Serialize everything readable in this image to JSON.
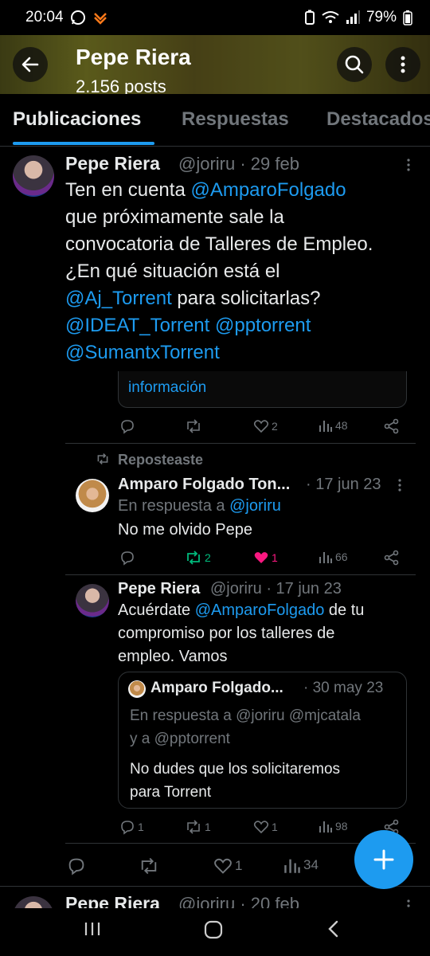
{
  "status_bar": {
    "time": "20:04",
    "battery": "79%"
  },
  "header": {
    "title": "Pepe Riera",
    "subtitle": "2.156 posts"
  },
  "tabs": [
    {
      "label": "Publicaciones",
      "active": true
    },
    {
      "label": "Respuestas",
      "active": false
    },
    {
      "label": "Destacados",
      "active": false
    }
  ],
  "main_post": {
    "name": "Pepe Riera",
    "handle": "@joriru",
    "date": "29 feb",
    "text_parts": {
      "t1": "Ten en cuenta ",
      "m1": "@AmparoFolgado",
      "t2": "que próximamente sale la",
      "t3": "convocatoria de Talleres de Empleo.",
      "t4": "¿En qué situación está el",
      "m2": "@Aj_Torrent",
      "t5": " para solicitarlas?",
      "m3": "@IDEAT_Torrent",
      "m4": "@pptorrent",
      "m5": "@SumantxTorrent"
    },
    "card_link": "información",
    "stats": {
      "replies": "",
      "reposts": "",
      "likes": "2",
      "views": "48"
    }
  },
  "reply_1": {
    "repost_label": "Reposteaste",
    "name": "Amparo Folgado Ton...",
    "date": "17 jun 23",
    "reply_to_label": "En respuesta a",
    "reply_to_handle": "@joriru",
    "text": "No me olvido Pepe",
    "stats": {
      "replies": "",
      "reposts": "2",
      "likes": "1",
      "views": "66"
    }
  },
  "reply_2": {
    "name": "Pepe Riera",
    "handle": "@joriru",
    "date": "17 jun 23",
    "text_parts": {
      "t1": "Acuérdate ",
      "m1": "@AmparoFolgado",
      "t2": "  de tu",
      "t3": "compromiso por los talleres de",
      "t4": "empleo. Vamos"
    },
    "quote": {
      "name": "Amparo Folgado...",
      "date": "30 may 23",
      "reply_line_1": "En respuesta a @joriru @mjcatala",
      "reply_line_2": "y a @pptorrent",
      "text_1": "No dudes que los solicitaremos",
      "text_2": "para Torrent"
    },
    "stats": {
      "replies": "1",
      "reposts": "1",
      "likes": "1",
      "views": "98"
    }
  },
  "thread_stats": {
    "replies": "",
    "reposts": "",
    "likes": "1",
    "views": "34"
  },
  "next_post": {
    "name": "Pepe Riera",
    "handle": "@joriru",
    "date": "20 feb"
  },
  "colors": {
    "accent": "#1d9bf0",
    "like": "#f91880",
    "repost_active": "#00ba7c",
    "muted": "#71767b"
  }
}
